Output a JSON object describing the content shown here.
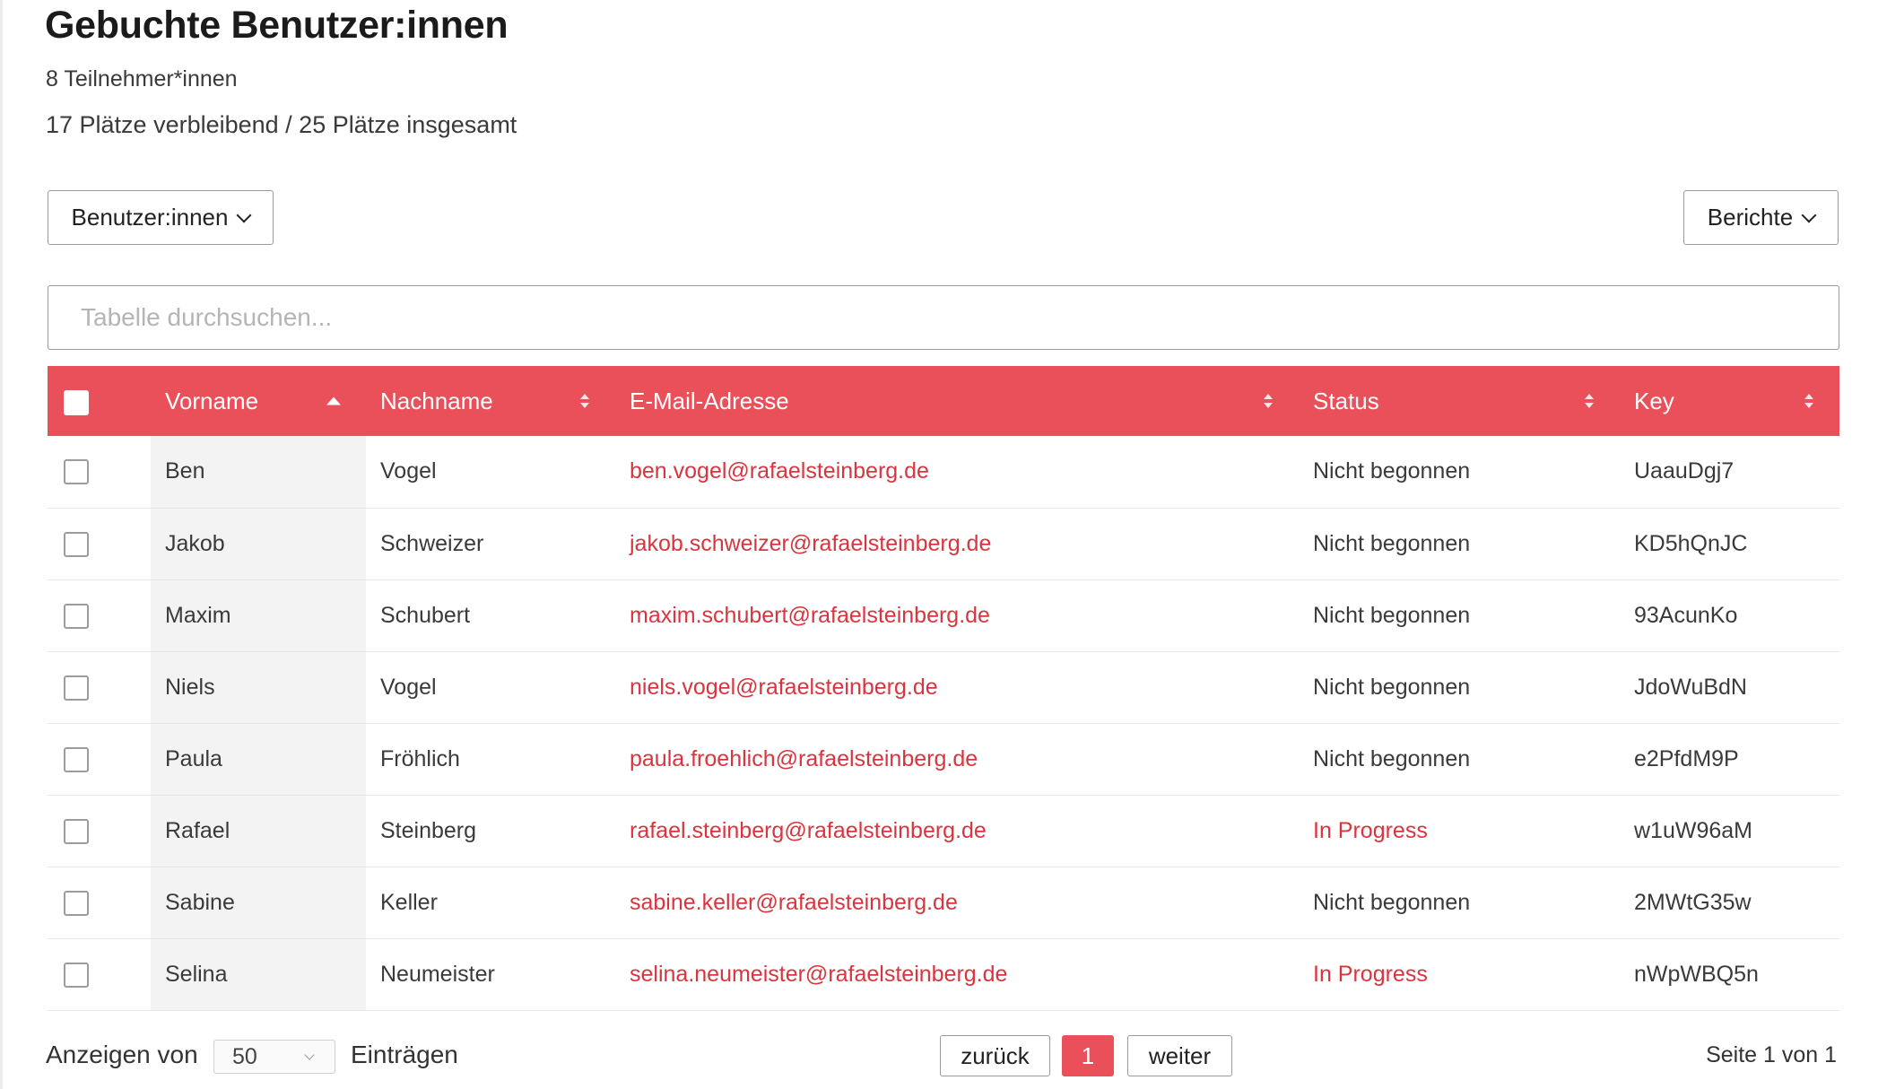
{
  "header": {
    "title": "Gebuchte Benutzer:innen",
    "participants": "8 Teilnehmer*innen",
    "seats": "17 Plätze verbleibend / 25 Plätze insgesamt"
  },
  "toolbar": {
    "users_label": "Benutzer:innen",
    "reports_label": "Berichte"
  },
  "search": {
    "placeholder": "Tabelle durchsuchen..."
  },
  "table": {
    "columns": [
      "Vorname",
      "Nachname",
      "E-Mail-Adresse",
      "Status",
      "Key"
    ],
    "sorted_column": "Vorname",
    "sort_direction": "ascending",
    "rows": [
      {
        "first": "Ben",
        "last": "Vogel",
        "email": "ben.vogel@rafaelsteinberg.de",
        "status": "Nicht begonnen",
        "key": "UaauDgj7"
      },
      {
        "first": "Jakob",
        "last": "Schweizer",
        "email": "jakob.schweizer@rafaelsteinberg.de",
        "status": "Nicht begonnen",
        "key": "KD5hQnJC"
      },
      {
        "first": "Maxim",
        "last": "Schubert",
        "email": "maxim.schubert@rafaelsteinberg.de",
        "status": "Nicht begonnen",
        "key": "93AcunKo"
      },
      {
        "first": "Niels",
        "last": "Vogel",
        "email": "niels.vogel@rafaelsteinberg.de",
        "status": "Nicht begonnen",
        "key": "JdoWuBdN"
      },
      {
        "first": "Paula",
        "last": "Fröhlich",
        "email": "paula.froehlich@rafaelsteinberg.de",
        "status": "Nicht begonnen",
        "key": "e2PfdM9P"
      },
      {
        "first": "Rafael",
        "last": "Steinberg",
        "email": "rafael.steinberg@rafaelsteinberg.de",
        "status": "In Progress",
        "key": "w1uW96aM"
      },
      {
        "first": "Sabine",
        "last": "Keller",
        "email": "sabine.keller@rafaelsteinberg.de",
        "status": "Nicht begonnen",
        "key": "2MWtG35w"
      },
      {
        "first": "Selina",
        "last": "Neumeister",
        "email": "selina.neumeister@rafaelsteinberg.de",
        "status": "In Progress",
        "key": "nWpWBQ5n"
      }
    ]
  },
  "footer": {
    "show_label": "Anzeigen von",
    "page_size": "50",
    "entries_label": "Einträgen",
    "prev_label": "zurück",
    "current_page": "1",
    "next_label": "weiter",
    "page_info": "Seite 1 von 1"
  },
  "colors": {
    "accent": "#e9505a",
    "link": "#d8353f"
  }
}
